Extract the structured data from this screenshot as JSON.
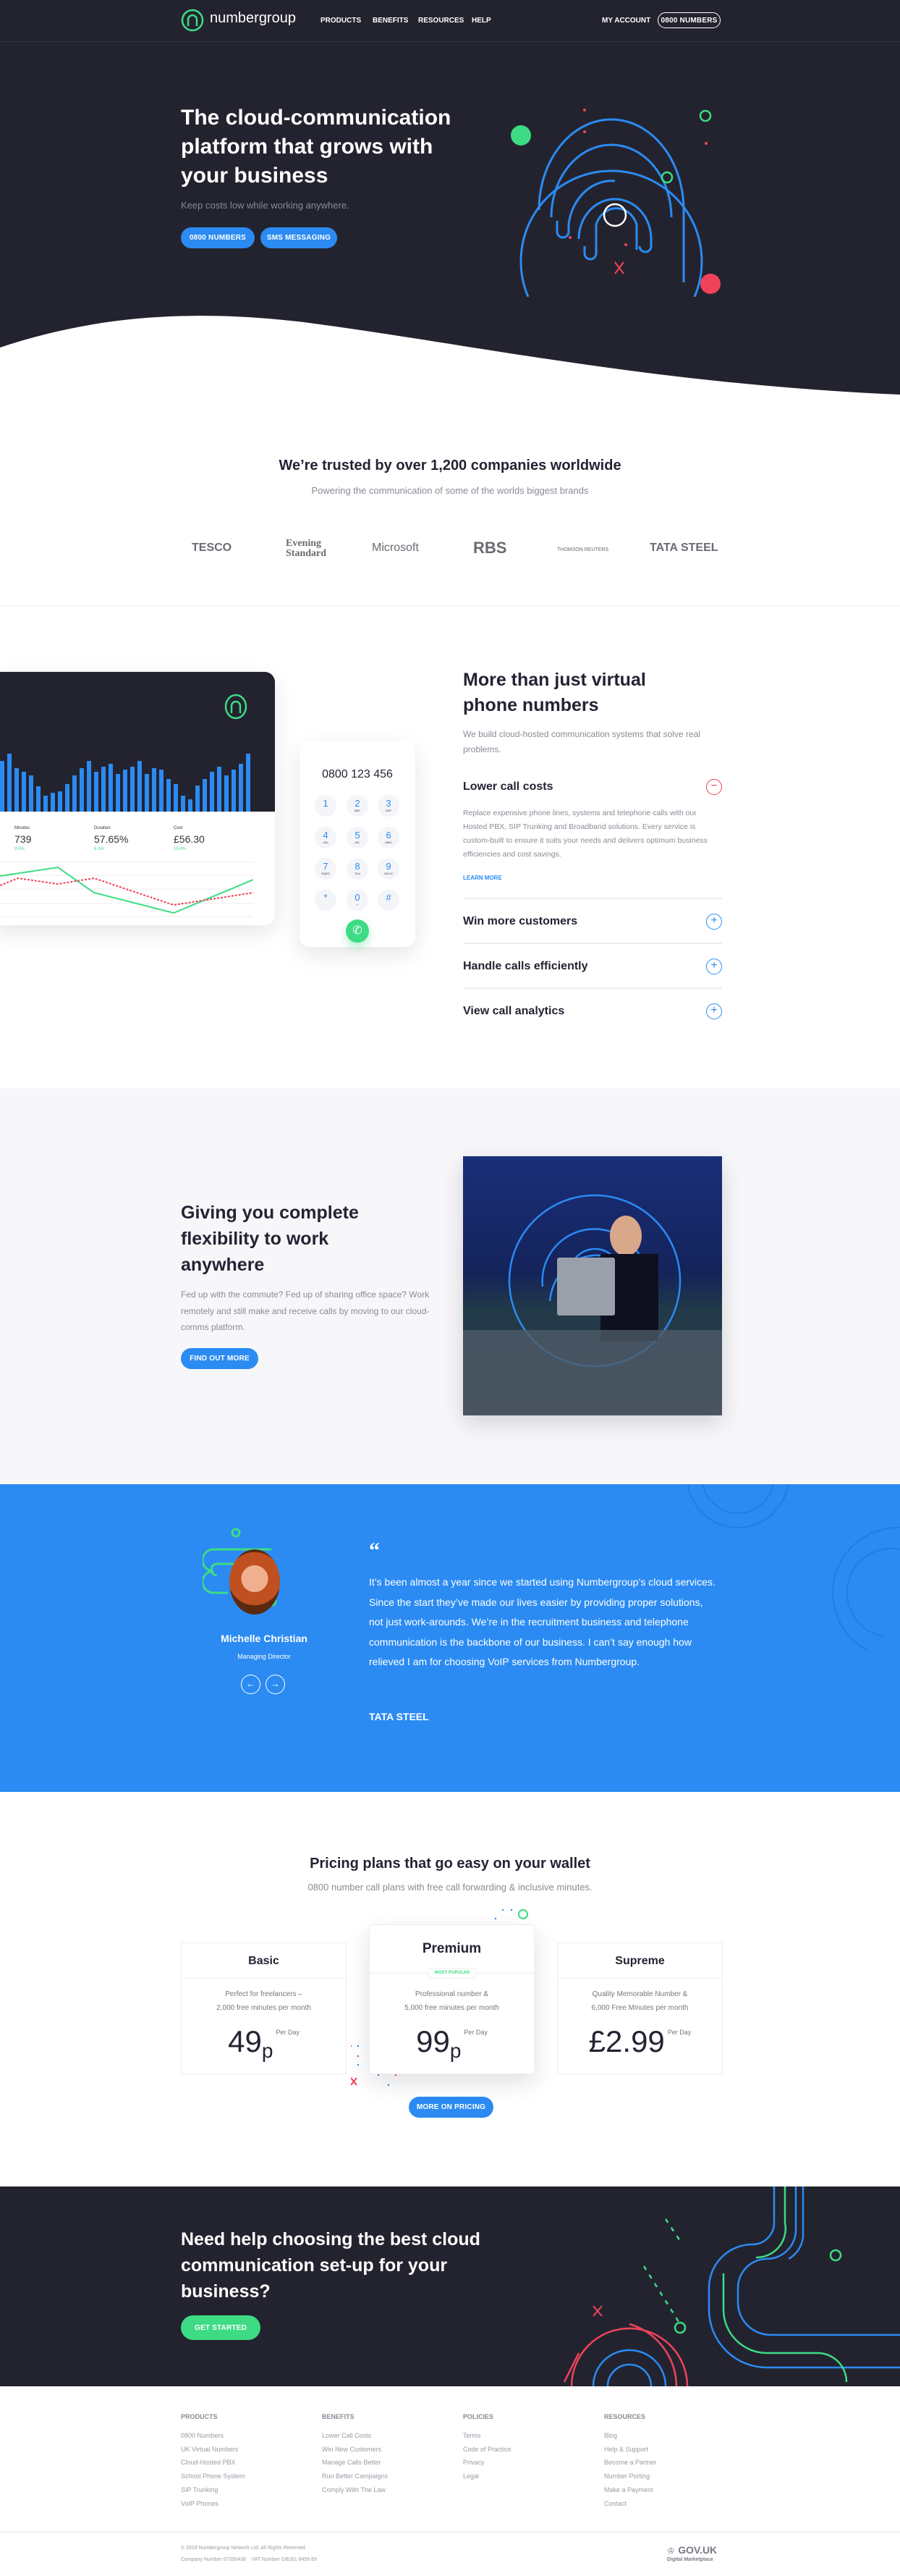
{
  "nav": {
    "brand": "numbergroup",
    "items": [
      "PRODUCTS",
      "BENEFITS",
      "RESOURCES",
      "HELP"
    ],
    "account": "MY ACCOUNT",
    "cta": "0800 NUMBERS"
  },
  "hero": {
    "title": "The cloud-communication platform that grows with your business",
    "subtitle": "Keep costs low while working anywhere.",
    "buttons": [
      "0800 NUMBERS",
      "SMS MESSAGING"
    ]
  },
  "trusted": {
    "title": "We’re trusted by over 1,200 companies worldwide",
    "subtitle": "Powering the communication of some of the worlds biggest brands",
    "logos": [
      "TESCO",
      "Evening Standard",
      "Microsoft",
      "RBS",
      "THOMSON REUTERS",
      "TATA STEEL"
    ]
  },
  "features": {
    "title": "More than just virtual phone numbers",
    "subtitle": "We build cloud-hosted communication systems that solve real problems.",
    "accordion": [
      {
        "title": "Lower call costs",
        "open": true,
        "body": "Replace expensive phone lines, systems and telephone calls with our Hosted PBX, SIP Trunking and Broadband solutions. Every service is custom-built to ensure it suits your needs and delivers optimum business efficiencies and cost savings.",
        "link": "LEARN MORE"
      },
      {
        "title": "Win more customers",
        "open": false
      },
      {
        "title": "Handle calls efficiently",
        "open": false
      },
      {
        "title": "View call analytics",
        "open": false
      }
    ],
    "dashboard": {
      "stats": [
        {
          "label": "Minutes",
          "value": "739",
          "change": "9.0%"
        },
        {
          "label": "Duration",
          "value": "57.65%",
          "change": "6.3%"
        },
        {
          "label": "Cost",
          "value": "£56.30",
          "change": "15.4%"
        }
      ]
    },
    "dialer": {
      "number": "0800 123 456",
      "keys": [
        [
          "1",
          ""
        ],
        [
          "2",
          "ABC"
        ],
        [
          "3",
          "DEF"
        ],
        [
          "4",
          "GHI"
        ],
        [
          "5",
          "JKL"
        ],
        [
          "6",
          "MNO"
        ],
        [
          "7",
          "PQRS"
        ],
        [
          "8",
          "TUV"
        ],
        [
          "9",
          "WXYZ"
        ],
        [
          "*",
          ""
        ],
        [
          "0",
          "+"
        ],
        [
          "#",
          ""
        ]
      ]
    }
  },
  "flex": {
    "title": "Giving you complete flexibility to work anywhere",
    "body": "Fed up with the commute? Fed up of sharing office space? Work remotely and still make and receive calls by moving to our cloud-comms platform.",
    "button": "FIND OUT MORE"
  },
  "testimonial": {
    "name": "Michelle Christian",
    "role": "Managing Director",
    "quote": "It’s been almost a year since we started using Numbergroup’s cloud services. Since the start they’ve made our lives easier by providing proper solutions, not just work-arounds. We’re in the recruitment business and telephone communication is the backbone of our business. I can’t say enough how relieved I am for choosing VoIP services from Numbergroup.",
    "company": "TATA STEEL"
  },
  "pricing": {
    "title": "Pricing plans that go easy on your wallet",
    "subtitle": "0800 number call plans with free call forwarding & inclusive minutes.",
    "plans": [
      {
        "name": "Basic",
        "desc1": "Perfect for freelancers –",
        "desc2": "2,000 free minutes per month",
        "price": "49",
        "unit": "p",
        "per": "Per Day"
      },
      {
        "name": "Premium",
        "badge": "MOST POPULAR",
        "desc1": "Professional number &",
        "desc2": "5,000 free minutes per month",
        "price": "99",
        "unit": "p",
        "per": "Per Day"
      },
      {
        "name": "Supreme",
        "desc1": "Quality Memorable Number &",
        "desc2": "6,000 Free Minutes per month",
        "price": "£2.99",
        "unit": "",
        "per": "Per Day"
      }
    ],
    "button": "MORE ON PRICING"
  },
  "cta": {
    "title": "Need help choosing the best cloud communication set-up for your business?",
    "button": "GET STARTED"
  },
  "footer": {
    "columns": [
      {
        "heading": "PRODUCTS",
        "links": [
          "0800 Numbers",
          "UK Virtual Numbers",
          "Cloud-Hosted PBX",
          "School Phone System",
          "SIP Trunking",
          "VoIP Phones"
        ]
      },
      {
        "heading": "BENEFITS",
        "links": [
          "Lower Call Costs",
          "Win New Customers",
          "Manage Calls Better",
          "Run Better Campaigns",
          "Comply With The Law"
        ]
      },
      {
        "heading": "POLICIES",
        "links": [
          "Terms",
          "Code of Practice",
          "Privacy",
          "Legal"
        ]
      },
      {
        "heading": "RESOURCES",
        "links": [
          "Blog",
          "Help & Support",
          "Become a Partner",
          "Number Porting",
          "Make a Payment",
          "Contact"
        ]
      }
    ],
    "copyright": "© 2019 Numbergroup Network Ltd. All Rights Reserved.",
    "company": "Company Number 07390438    VAT Number GB261 8456 89",
    "gov": "GOV.UK",
    "gov_sub": "Digital Marketplace"
  },
  "colors": {
    "dark": "#23232f",
    "blue": "#2b8bf2",
    "green": "#3ddc84",
    "red": "#f0435a"
  }
}
